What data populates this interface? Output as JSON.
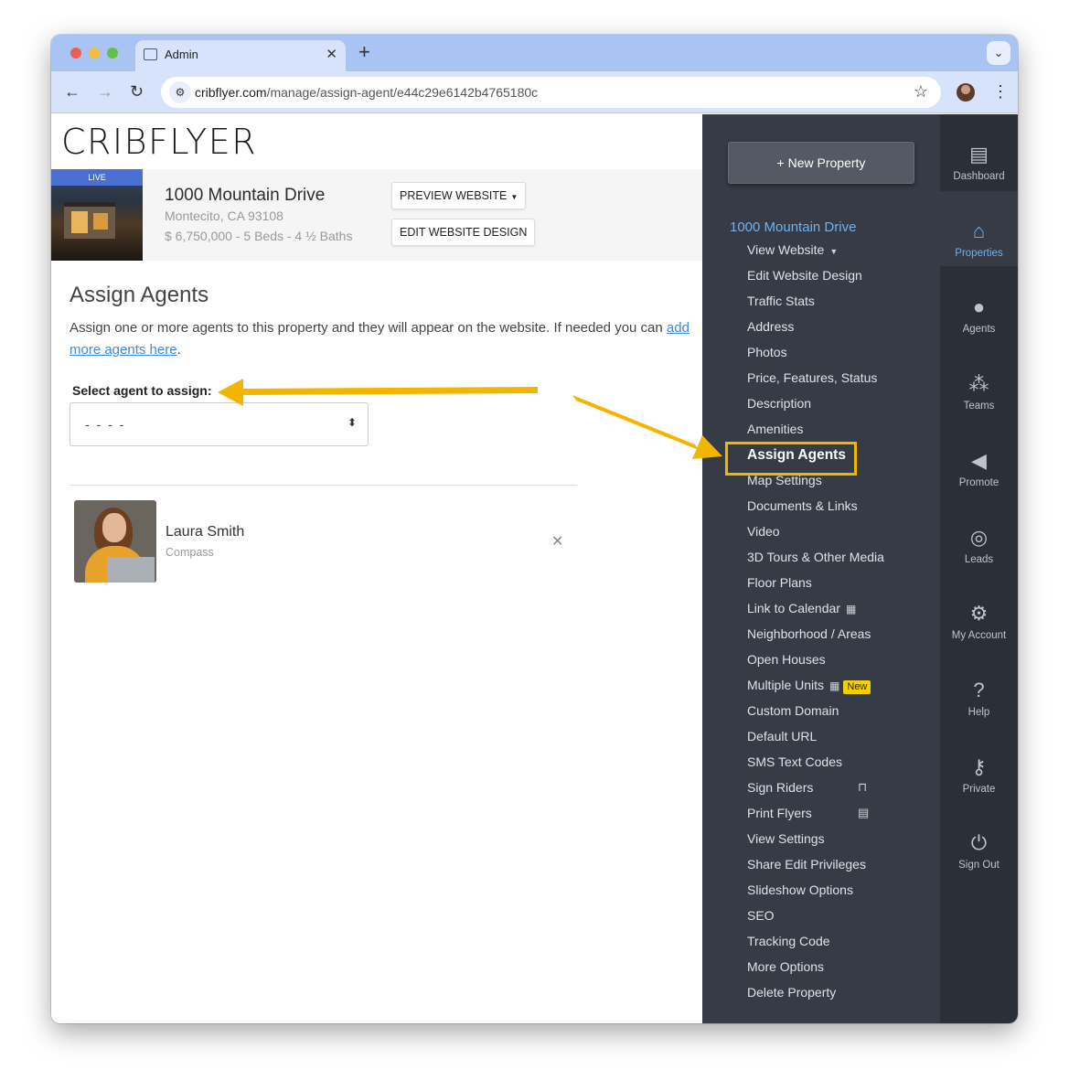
{
  "browser": {
    "tab_title": "Admin",
    "url_domain": "cribflyer.com",
    "url_path": "/manage/assign-agent/e44c29e6142b4765180c"
  },
  "logo": "CRIBFLYER",
  "property": {
    "live_label": "LIVE",
    "title": "1000 Mountain Drive",
    "address": "Montecito, CA 93108",
    "details": "$ 6,750,000 - 5 Beds - 4 ½ Baths",
    "preview_button": "PREVIEW WEBSITE",
    "edit_button": "EDIT WEBSITE DESIGN"
  },
  "assign": {
    "heading": "Assign Agents",
    "description": "Assign one or more agents to this property and they will appear on the website. If needed you can",
    "link_text": "add more agents here",
    "period": ".",
    "select_label": "Select agent to assign:",
    "select_value": "- - - -"
  },
  "agents": [
    {
      "name": "Laura Smith",
      "company": "Compass"
    }
  ],
  "sidebar": {
    "new_property_button": "New Property",
    "property_link": "1000 Mountain Drive",
    "menu": [
      "View Website",
      "Edit Website Design",
      "Traffic Stats",
      "Address",
      "Photos",
      "Price, Features, Status",
      "Description",
      "Amenities",
      "Assign Agents",
      "Map Settings",
      "Documents & Links",
      "Video",
      "3D Tours & Other Media",
      "Floor Plans",
      "Link to Calendar",
      "Neighborhood / Areas",
      "Open Houses",
      "Multiple Units",
      "Custom Domain",
      "Default URL",
      "SMS Text Codes",
      "Sign Riders",
      "Print Flyers",
      "View Settings",
      "Share Edit Privileges",
      "Slideshow Options",
      "SEO",
      "Tracking Code",
      "More Options",
      "Delete Property"
    ],
    "active_item": "Assign Agents",
    "new_badge": "New"
  },
  "rail": [
    {
      "label": "Dashboard",
      "icon": "dashboard-icon"
    },
    {
      "label": "Properties",
      "icon": "properties-icon"
    },
    {
      "label": "Agents",
      "icon": "agent-icon"
    },
    {
      "label": "Teams",
      "icon": "teams-icon"
    },
    {
      "label": "Promote",
      "icon": "megaphone-icon"
    },
    {
      "label": "Leads",
      "icon": "target-icon"
    },
    {
      "label": "My Account",
      "icon": "gear-icon"
    },
    {
      "label": "Help",
      "icon": "help-icon"
    },
    {
      "label": "Private",
      "icon": "key-icon"
    },
    {
      "label": "Sign Out",
      "icon": "power-icon"
    }
  ],
  "colors": {
    "sidebar_bg": "#363b45",
    "rail_bg": "#2b2f37",
    "link_blue": "#6fb2f0",
    "highlight_yellow": "#f2b600"
  }
}
